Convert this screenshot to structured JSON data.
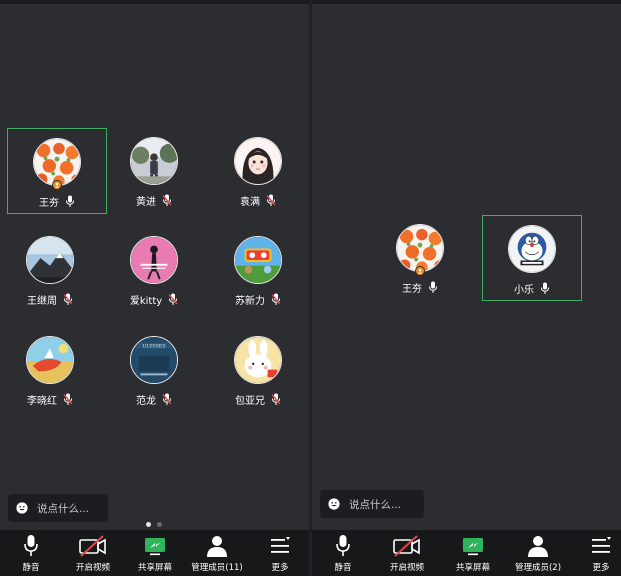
{
  "colors": {
    "accent": "#3fae62",
    "mic_muted": "#e0464a",
    "host_badge": "#f08a24",
    "share_green": "#2fb35b"
  },
  "left_panel": {
    "participants": [
      {
        "name": "王夯",
        "mic": "on",
        "active": true,
        "host": true,
        "avatar": "oranges-avatar"
      },
      {
        "name": "黄进",
        "mic": "muted",
        "avatar": "person-outdoor-avatar"
      },
      {
        "name": "袁满",
        "mic": "muted",
        "avatar": "anime-girl-avatar"
      },
      {
        "name": "王继周",
        "mic": "muted",
        "avatar": "mountain-avatar"
      },
      {
        "name": "爱kitty",
        "mic": "muted",
        "avatar": "pink-figure-avatar"
      },
      {
        "name": "苏新力",
        "mic": "muted",
        "avatar": "toy-story-avatar"
      },
      {
        "name": "李晓红",
        "mic": "muted",
        "avatar": "painting-avatar"
      },
      {
        "name": "范龙",
        "mic": "muted",
        "avatar": "book-cover-avatar"
      },
      {
        "name": "包亚兄",
        "mic": "muted",
        "avatar": "rabbit-avatar"
      }
    ],
    "chat_placeholder": "说点什么...",
    "page_count": 2,
    "current_page": 1,
    "toolbar": {
      "mute": "静音",
      "video": "开启视频",
      "share": "共享屏幕",
      "members": "管理成员(11)",
      "more": "更多"
    }
  },
  "right_panel": {
    "participants": [
      {
        "name": "王夯",
        "mic": "on",
        "host": true,
        "avatar": "oranges-avatar"
      },
      {
        "name": "小乐",
        "mic": "on",
        "active": true,
        "avatar": "doraemon-avatar"
      }
    ],
    "chat_placeholder": "说点什么...",
    "toolbar": {
      "mute": "静音",
      "video": "开启视频",
      "share": "共享屏幕",
      "members": "管理成员(2)",
      "more": "更多"
    }
  }
}
